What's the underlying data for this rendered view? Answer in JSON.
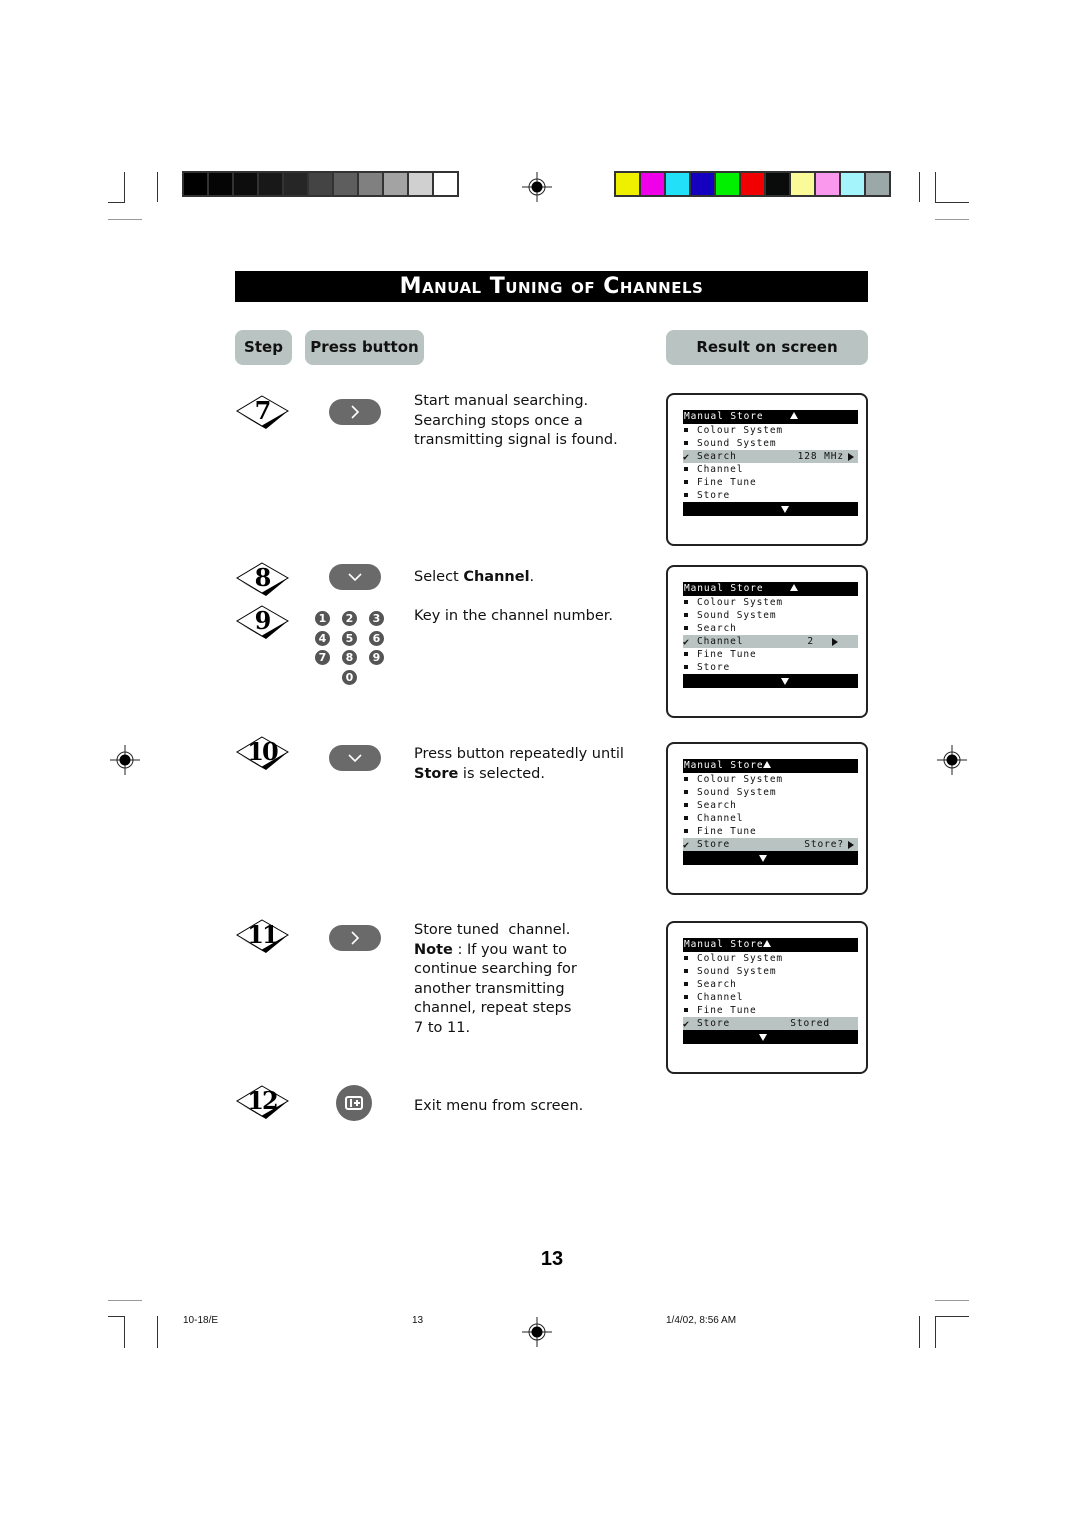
{
  "print_marks": {
    "grayscale_swatches": [
      "#000000",
      "#050505",
      "#0d0d0d",
      "#181818",
      "#262626",
      "#444444",
      "#5e5e5e",
      "#808080",
      "#a3a3a3",
      "#d0d0d0",
      "#ffffff"
    ],
    "color_swatches": [
      "#eef000",
      "#f000e8",
      "#22e0f8",
      "#1600c0",
      "#00f000",
      "#f00000",
      "#0a0c0c",
      "#fafa98",
      "#fa98ee",
      "#a4f4fc",
      "#9aa8a8"
    ]
  },
  "title": "Manual Tuning of Channels",
  "headers": {
    "step": "Step",
    "press_button": "Press button",
    "result": "Result on screen"
  },
  "steps": [
    {
      "number": "7",
      "button": "right-arrow",
      "text": "Start manual searching. Searching stops once a transmitting signal is found.",
      "screen": {
        "title": "Manual Store",
        "items": [
          "Colour System",
          "Sound System",
          "Search",
          "Channel",
          "Fine Tune",
          "Store"
        ],
        "selected": "Search",
        "value": "128 MHz"
      }
    },
    {
      "number": "8",
      "button": "down-arrow",
      "text_pre": "Select ",
      "text_bold": "Channel",
      "text_post": ".",
      "screen": {
        "title": "Manual Store",
        "items": [
          "Colour System",
          "Sound System",
          "Search",
          "Channel",
          "Fine Tune",
          "Store"
        ],
        "selected": "Channel",
        "value": "2"
      }
    },
    {
      "number": "9",
      "button": "number-keys",
      "keys": [
        "1",
        "2",
        "3",
        "4",
        "5",
        "6",
        "7",
        "8",
        "9",
        "0"
      ],
      "text": "Key in the channel number."
    },
    {
      "number": "10",
      "button": "down-arrow",
      "text_line1": "Press button repeatedly until",
      "text_bold": "Store",
      "text_post": " is selected.",
      "screen": {
        "title": "Manual Store",
        "items": [
          "Colour System",
          "Sound System",
          "Search",
          "Channel",
          "Fine Tune",
          "Store"
        ],
        "selected": "Store",
        "value": "Store?"
      }
    },
    {
      "number": "11",
      "button": "right-arrow",
      "text_line1": "Store tuned  channel.",
      "note_label": "Note",
      "note_lines": [
        " : If you want to",
        "continue searching for",
        "another transmitting",
        "channel, repeat steps",
        "7 to 11."
      ],
      "screen": {
        "title": "Manual Store",
        "items": [
          "Colour System",
          "Sound System",
          "Search",
          "Channel",
          "Fine Tune",
          "Store"
        ],
        "selected": "Store",
        "value": "Stored"
      }
    },
    {
      "number": "12",
      "button": "osd-info",
      "text": "Exit menu from screen."
    }
  ],
  "page_number": "13",
  "footer": {
    "code": "10-18/E",
    "page": "13",
    "timestamp": "1/4/02, 8:56 AM"
  }
}
